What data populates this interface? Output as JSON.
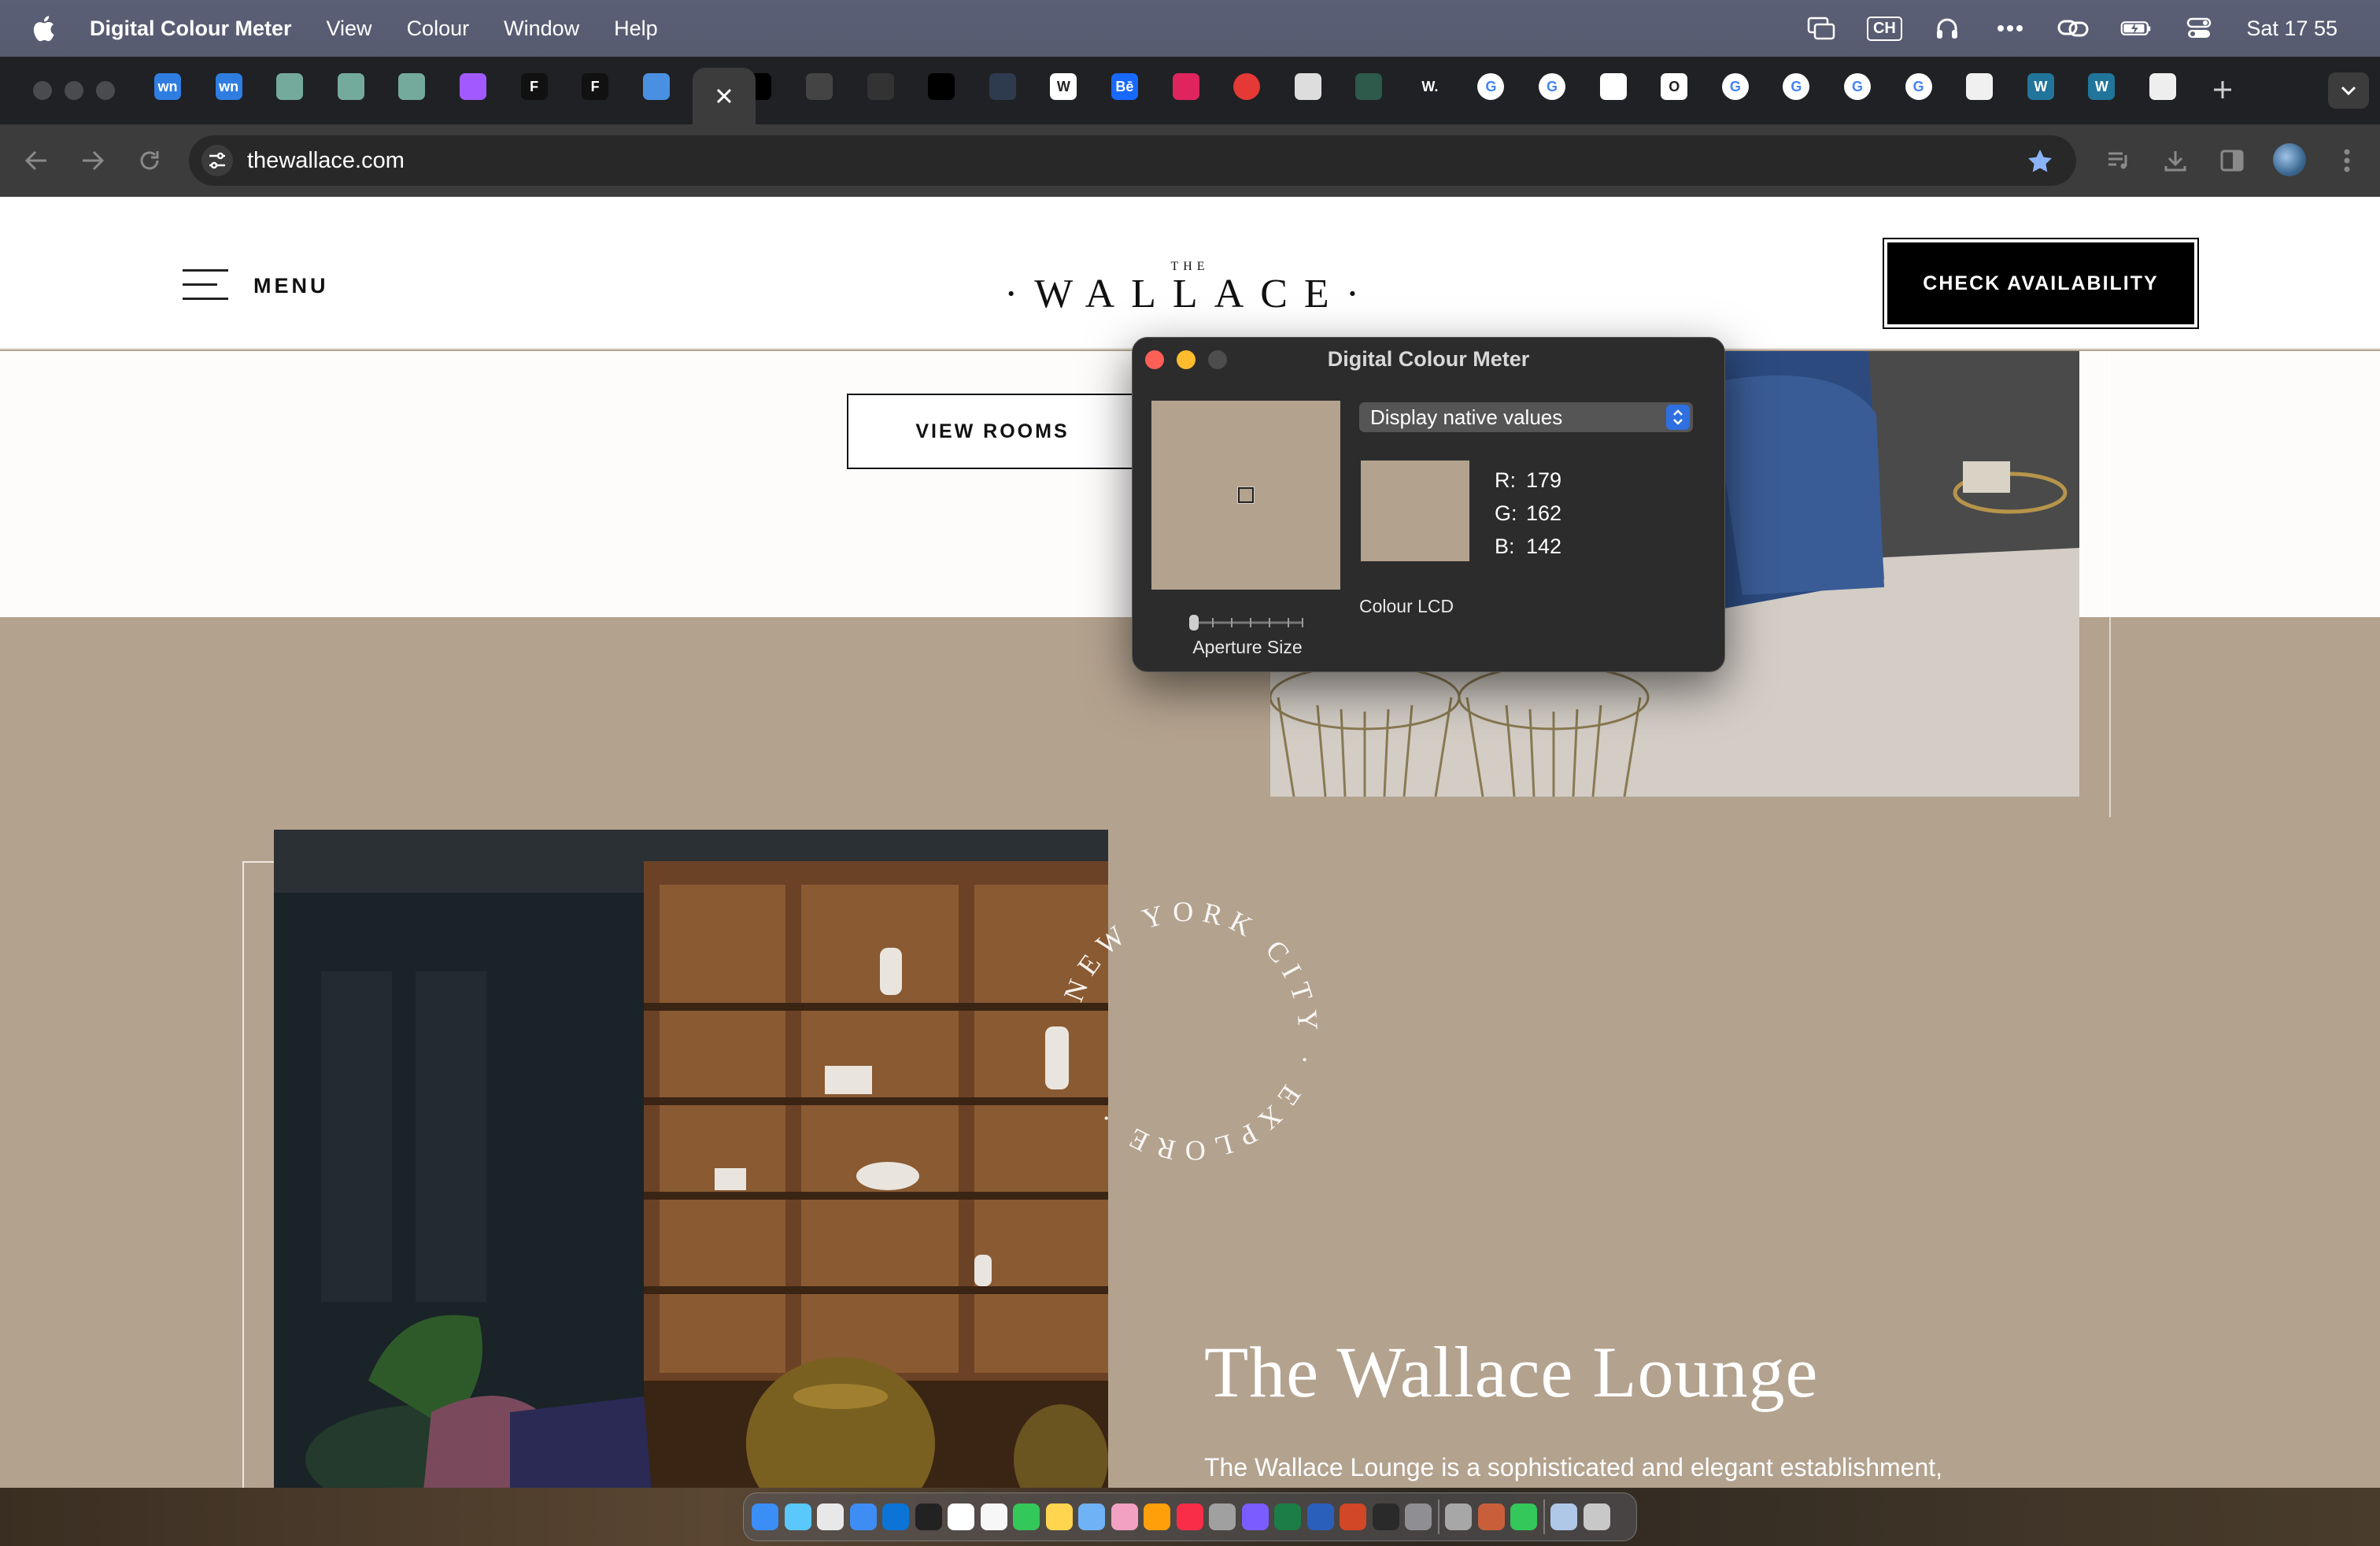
{
  "menubar": {
    "app_name": "Digital Colour Meter",
    "menus": [
      "View",
      "Colour",
      "Window",
      "Help"
    ],
    "ch_label": "CH",
    "clock": "Sat 17 55"
  },
  "browser": {
    "url": "thewallace.com",
    "tab_favicons": [
      {
        "icon": "webnode-icon",
        "color": "#2f7de1",
        "label": "wn"
      },
      {
        "icon": "webnode-icon",
        "color": "#2f7de1",
        "label": "wn"
      },
      {
        "icon": "chatgpt-icon",
        "color": "#74aa9c",
        "label": ""
      },
      {
        "icon": "chatgpt-icon",
        "color": "#74aa9c",
        "label": ""
      },
      {
        "icon": "chatgpt-icon",
        "color": "#74aa9c",
        "label": ""
      },
      {
        "icon": "figma-icon",
        "color": "#a259ff",
        "label": ""
      },
      {
        "icon": "framer-icon",
        "color": "#111111",
        "label": "F"
      },
      {
        "icon": "framer-icon",
        "color": "#111111",
        "label": "F"
      },
      {
        "icon": "browser-icon",
        "color": "#4a90e2",
        "label": ""
      },
      {
        "icon": "site-icon",
        "color": "#000000",
        "label": ""
      },
      {
        "icon": "site-icon",
        "color": "#444444",
        "label": ""
      },
      {
        "icon": "site-icon",
        "color": "#333333",
        "label": ""
      },
      {
        "icon": "site-icon",
        "color": "#000000",
        "label": ""
      },
      {
        "icon": "site-icon",
        "color": "#2e3b4e",
        "label": ""
      },
      {
        "icon": "wikipedia-icon",
        "color": "#ffffff",
        "label": "W"
      },
      {
        "icon": "behance-icon",
        "color": "#1769ff",
        "label": "Bē"
      },
      {
        "icon": "heart-icon",
        "color": "#e0245e",
        "label": ""
      },
      {
        "icon": "record-icon",
        "color": "#e53935",
        "label": ""
      },
      {
        "icon": "site-icon",
        "color": "#dddddd",
        "label": ""
      },
      {
        "icon": "site-icon",
        "color": "#2d5a4a",
        "label": ""
      },
      {
        "icon": "site-icon",
        "color": "#202124",
        "label": "W."
      },
      {
        "icon": "google-icon",
        "color": "#ffffff",
        "label": "G"
      },
      {
        "icon": "google-icon",
        "color": "#ffffff",
        "label": "G"
      },
      {
        "icon": "site-icon",
        "color": "#ffffff",
        "label": ""
      },
      {
        "icon": "site-icon",
        "color": "#ffffff",
        "label": "O"
      },
      {
        "icon": "google-icon",
        "color": "#ffffff",
        "label": "G"
      },
      {
        "icon": "google-icon",
        "color": "#ffffff",
        "label": "G"
      },
      {
        "icon": "google-icon",
        "color": "#ffffff",
        "label": "G"
      },
      {
        "icon": "google-icon",
        "color": "#ffffff",
        "label": "G"
      },
      {
        "icon": "site-icon",
        "color": "#f0f0f0",
        "label": ""
      },
      {
        "icon": "wordpress-icon",
        "color": "#21759b",
        "label": "W"
      },
      {
        "icon": "wordpress-icon",
        "color": "#21759b",
        "label": "W"
      },
      {
        "icon": "site-icon",
        "color": "#eeeeee",
        "label": ""
      }
    ]
  },
  "site": {
    "menu_label": "MENU",
    "logo_small": "THE",
    "logo": "·WALLACE·",
    "cta": "CHECK AVAILABILITY",
    "view_rooms": "VIEW ROOMS",
    "circle_text": "NEW YORK CITY · EXPLORE ·",
    "lounge_title": "The Wallace Lounge",
    "lounge_desc": "The Wallace Lounge is a sophisticated and elegant establishment,",
    "bg_color": "#b3a28e"
  },
  "colour_meter": {
    "title": "Digital Colour Meter",
    "mode": "Display native values",
    "r_label": "R:",
    "r": "179",
    "g_label": "G:",
    "g": "162",
    "b_label": "B:",
    "b": "142",
    "profile": "Colour LCD",
    "aperture_label": "Aperture Size",
    "sample_color": "#b3a28e"
  },
  "dock": {
    "apps": [
      "finder",
      "safari",
      "chrome",
      "mail",
      "vscode",
      "terminal",
      "calendar",
      "reminders",
      "messages",
      "notes",
      "preview",
      "photos",
      "photos2",
      "music",
      "bookmark",
      "arc",
      "excel",
      "word",
      "powerpoint",
      "activity",
      "settings",
      "sep",
      "screenshot",
      "colour-meter",
      "facetime",
      "sep",
      "downloads",
      "trash"
    ]
  }
}
